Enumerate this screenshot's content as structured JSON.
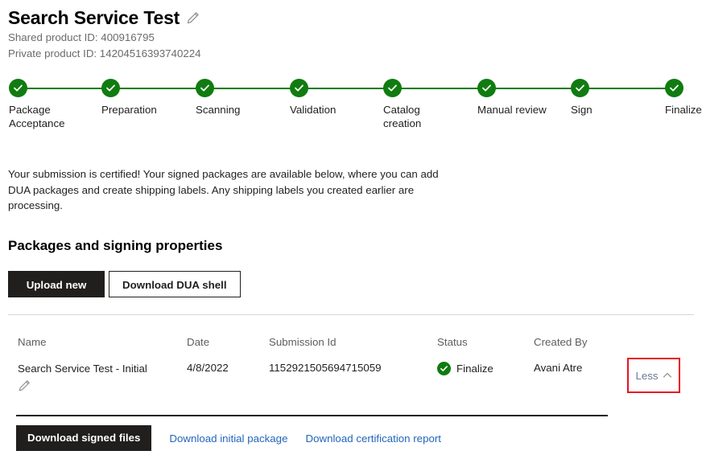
{
  "header": {
    "title": "Search Service Test",
    "edit_icon": "pencil-icon",
    "shared_product_id": "Shared product ID: 400916795",
    "private_product_id": "Private product ID: 14204516393740224"
  },
  "stepper": {
    "accent_color": "#107c10",
    "steps": [
      {
        "label": "Package Acceptance",
        "state": "complete",
        "icon": "check-icon"
      },
      {
        "label": "Preparation",
        "state": "complete",
        "icon": "check-icon"
      },
      {
        "label": "Scanning",
        "state": "complete",
        "icon": "check-icon"
      },
      {
        "label": "Validation",
        "state": "complete",
        "icon": "check-icon"
      },
      {
        "label": "Catalog creation",
        "state": "complete",
        "icon": "check-icon"
      },
      {
        "label": "Manual review",
        "state": "complete",
        "icon": "check-icon"
      },
      {
        "label": "Sign",
        "state": "complete",
        "icon": "check-icon"
      },
      {
        "label": "Finalize",
        "state": "complete",
        "icon": "check-icon"
      }
    ]
  },
  "description": "Your submission is certified! Your signed packages are available below, where you can add DUA packages and create shipping labels. Any shipping labels you created earlier are processing.",
  "section": {
    "title": "Packages and signing properties",
    "upload_new_label": "Upload new",
    "download_dua_shell_label": "Download DUA shell"
  },
  "table": {
    "columns": [
      "Name",
      "Date",
      "Submission Id",
      "Status",
      "Created By"
    ],
    "rows": [
      {
        "name": "Search Service Test - Initial",
        "name_edit_icon": "pencil-icon",
        "date": "4/8/2022",
        "submission_id": "1152921505694715059",
        "status": "Finalize",
        "status_icon": "check-circle-icon",
        "status_color": "#107c10",
        "created_by": "Avani Atre",
        "expand_toggle_label": "Less",
        "expand_toggle_icon": "chevron-up-icon",
        "highlight_color": "#e81123"
      }
    ]
  },
  "footer": {
    "download_signed_files_label": "Download signed files",
    "download_initial_package_label": "Download initial package",
    "download_certification_report_label": "Download certification report",
    "link_color": "#2266bb"
  }
}
